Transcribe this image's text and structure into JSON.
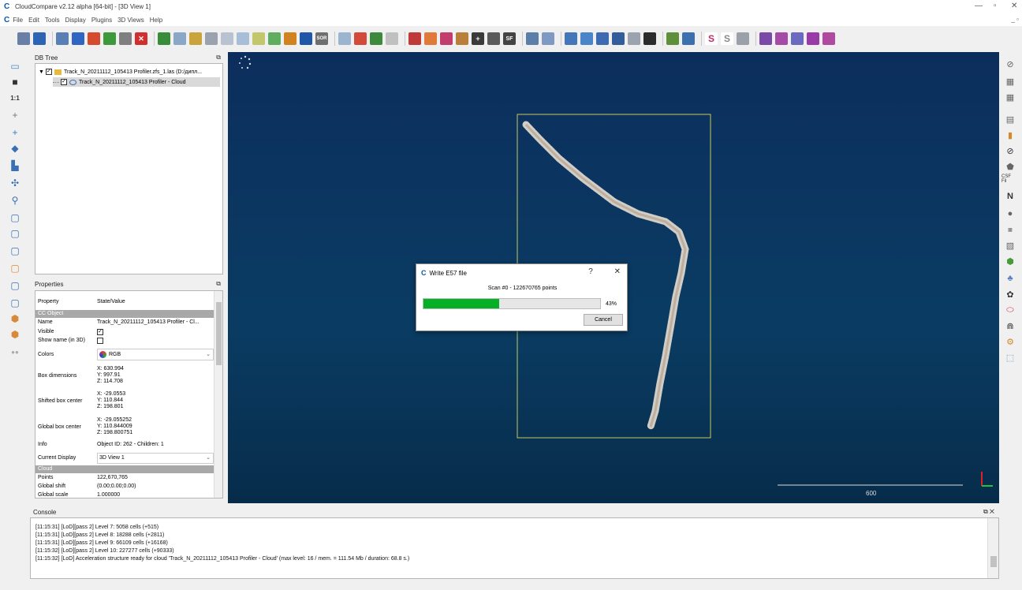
{
  "window": {
    "title": "CloudCompare v2.12 alpha [64-bit] - [3D View 1]"
  },
  "menu": [
    "File",
    "Edit",
    "Tools",
    "Display",
    "Plugins",
    "3D Views",
    "Help"
  ],
  "db_tree": {
    "title": "DB Tree",
    "items": [
      {
        "label": "Track_N_20211112_105413 Profiler.zfs_1.las (D:/дипл..."
      },
      {
        "label": "Track_N_20211112_105413 Profiler - Cloud"
      }
    ]
  },
  "properties": {
    "title": "Properties",
    "header": {
      "property": "Property",
      "value": "State/Value"
    },
    "section_object": "CC Object",
    "name": {
      "label": "Name",
      "value": "Track_N_20211112_105413 Profiler - Cl..."
    },
    "visible": {
      "label": "Visible"
    },
    "show_name": {
      "label": "Show name (in 3D)"
    },
    "colors": {
      "label": "Colors",
      "value": "RGB"
    },
    "box_dims": {
      "label": "Box dimensions",
      "x": "X: 630.994",
      "y": "Y: 997.91",
      "z": "Z: 114.708"
    },
    "shifted_center": {
      "label": "Shifted box center",
      "x": "X: -29.0553",
      "y": "Y: 110.844",
      "z": "Z: 198.801"
    },
    "global_center": {
      "label": "Global box center",
      "x": "X: -29.055252",
      "y": "Y: 110.844009",
      "z": "Z: 198.800751"
    },
    "info": {
      "label": "Info",
      "value": "Object ID: 262 - Children: 1"
    },
    "current_display": {
      "label": "Current Display",
      "value": "3D View 1"
    },
    "section_cloud": "Cloud",
    "points": {
      "label": "Points",
      "value": "122,670,765"
    },
    "global_shift": {
      "label": "Global shift",
      "value": "(0.00;0.00;0.00)"
    },
    "global_scale": {
      "label": "Global scale",
      "value": "1.000000"
    }
  },
  "viewer": {
    "scale_label": "600"
  },
  "dialog": {
    "title": "Write E57 file",
    "help": "?",
    "close": "✕",
    "message": "Scan #0 - 122670765 points",
    "progress": 0.43,
    "progress_label": "43%",
    "cancel": "Cancel"
  },
  "console": {
    "title": "Console",
    "lines": [
      "[11:15:31] [LoD][pass 2] Level 7: 5058 cells (+515)",
      "[11:15:31] [LoD][pass 2] Level 8: 18288 cells (+2811)",
      "[11:15:31] [LoD][pass 2] Level 9: 66109 cells (+16168)",
      "[11:15:32] [LoD][pass 2] Level 10: 227277 cells (+90333)",
      "[11:15:32] [LoD] Acceleration structure ready for cloud 'Track_N_20211112_105413 Profiler - Cloud' (max level: 16 / mem. = 111.54 Mb / duration: 68.8 s.)"
    ]
  },
  "colors": {
    "progress": "#06b025",
    "viewer_top": "#0c2e5d",
    "bbox": "#c8c85a"
  }
}
